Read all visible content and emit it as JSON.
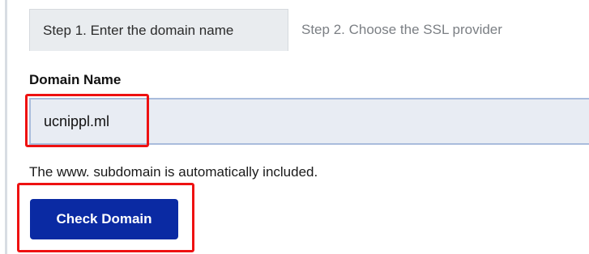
{
  "tabs": [
    {
      "label": "Step 1. Enter the domain name",
      "active": true
    },
    {
      "label": "Step 2. Choose the SSL provider",
      "active": false
    }
  ],
  "form": {
    "domain_label": "Domain Name",
    "domain_value": "ucnippl.ml",
    "hint": "The www. subdomain is automatically included.",
    "check_button_label": "Check Domain"
  },
  "colors": {
    "button_bg": "#0a2aa3",
    "highlight": "#ee1111",
    "input_bg": "#e8ecf3",
    "input_border": "#a9bcdc"
  }
}
